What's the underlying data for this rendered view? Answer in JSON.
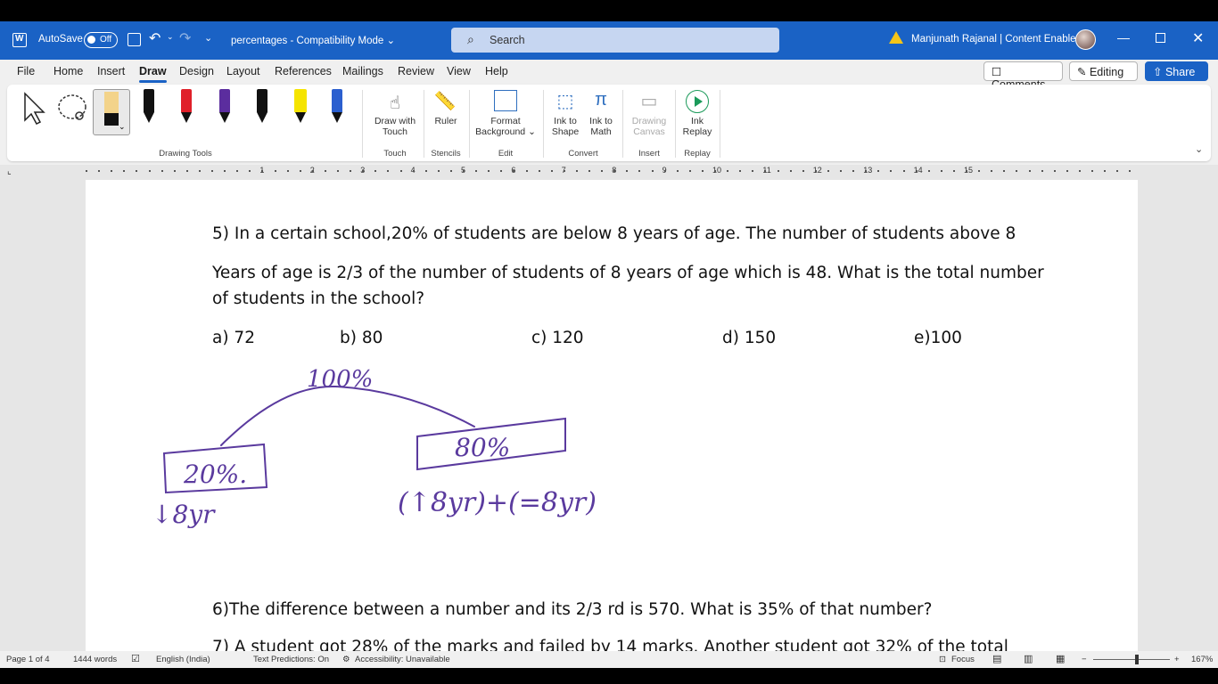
{
  "titlebar": {
    "autosave": "AutoSave",
    "toggle": "Off",
    "doc_title": "percentages  -  Compatibility Mode ⌄",
    "search_placeholder": "Search",
    "user": "Manjunath Rajanal | Content Enablers",
    "minimize": "—",
    "close": "✕"
  },
  "tabs": [
    "File",
    "Home",
    "Insert",
    "Draw",
    "Design",
    "Layout",
    "References",
    "Mailings",
    "Review",
    "View",
    "Help"
  ],
  "active_tab": "Draw",
  "actions": {
    "comments": "☐ Comments",
    "editing": "✎ Editing ⌄",
    "share": "⇧ Share ⌄"
  },
  "ribbon": {
    "draw_with_touch_1": "Draw with",
    "draw_with_touch_2": "Touch",
    "ruler": "Ruler",
    "format_bg_1": "Format",
    "format_bg_2": "Background ⌄",
    "ink_to_shape_1": "Ink to",
    "ink_to_shape_2": "Shape",
    "ink_to_math_1": "Ink to",
    "ink_to_math_2": "Math",
    "drawing_canvas_1": "Drawing",
    "drawing_canvas_2": "Canvas",
    "ink_replay_1": "Ink",
    "ink_replay_2": "Replay",
    "groups": {
      "drawing_tools": "Drawing Tools",
      "touch": "Touch",
      "stencils": "Stencils",
      "edit": "Edit",
      "convert": "Convert",
      "insert": "Insert",
      "replay": "Replay"
    },
    "pen_colors": [
      "#111111",
      "#e0202a",
      "#5b2d9e",
      "#111111",
      "#f5e400",
      "#2b5fcf"
    ]
  },
  "ruler_numbers": [
    "1",
    "2",
    "3",
    "4",
    "5",
    "6",
    "7",
    "8",
    "9",
    "10",
    "11",
    "12",
    "13",
    "14",
    "15"
  ],
  "document": {
    "q5_line1": "5) In a certain school,20% of students are below 8 years of age. The number of students above 8",
    "q5_line2": "Years of age is 2/3 of the number of students of 8 years of age which is 48. What is the total number",
    "q5_line3": "of students in the school?",
    "opt_a": "a) 72",
    "opt_b": "b) 80",
    "opt_c": "c) 120",
    "opt_d": "d) 150",
    "opt_e": "e)100",
    "q6": "6)The difference between a number and its 2/3 rd is 570. What is 35% of that number?",
    "q7_partial": "7) A student got 28% of the marks and failed by 14 marks. Another student got 32% of the total"
  },
  "ink": {
    "top": "100%",
    "left_box": "20%.",
    "left_note": "↓8yr",
    "right_box": "80%",
    "right_note": "(↑8yr)+(=8yr)",
    "color": "#5a3a9e"
  },
  "status": {
    "page": "Page 1 of 4",
    "words": "1444 words",
    "language": "English (India)",
    "predictions": "Text Predictions: On",
    "accessibility": "Accessibility: Unavailable",
    "focus": "Focus",
    "zoom": "167%"
  }
}
